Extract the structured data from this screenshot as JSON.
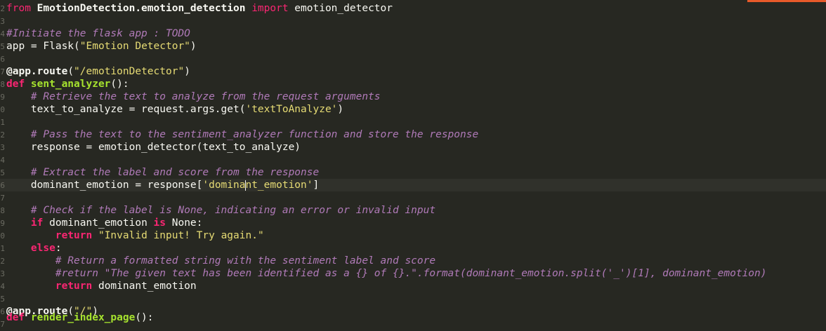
{
  "editor": {
    "line_numbers": [
      "2",
      "3",
      "4",
      "5",
      "6",
      "7",
      "8",
      "9",
      "0",
      "1",
      "2",
      "3",
      "4",
      "5",
      "6",
      "7",
      "8",
      "9",
      "0",
      "1",
      "2",
      "3",
      "4",
      "5",
      "6",
      "7"
    ],
    "lines": [
      {
        "tokens": [
          [
            "kw",
            "from "
          ],
          [
            "mod",
            "EmotionDetection.emotion_detection"
          ],
          [
            "kw",
            " import"
          ],
          [
            "plain",
            " emotion_detector"
          ]
        ]
      },
      {
        "tokens": []
      },
      {
        "tokens": [
          [
            "cm",
            "#Initiate the flask app : TODO"
          ]
        ]
      },
      {
        "tokens": [
          [
            "plain",
            "app = Flask("
          ],
          [
            "str",
            "\"Emotion Detector\""
          ],
          [
            "plain",
            ")"
          ]
        ]
      },
      {
        "tokens": []
      },
      {
        "tokens": [
          [
            "dec",
            "@app.route"
          ],
          [
            "plain",
            "("
          ],
          [
            "str",
            "\"/emotionDetector\""
          ],
          [
            "plain",
            ")"
          ]
        ]
      },
      {
        "tokens": [
          [
            "kwb",
            "def "
          ],
          [
            "fn",
            "sent_analyzer"
          ],
          [
            "plain",
            "():"
          ]
        ]
      },
      {
        "tokens": [
          [
            "plain",
            "    "
          ],
          [
            "cm",
            "# Retrieve the text to analyze from the request arguments"
          ]
        ]
      },
      {
        "tokens": [
          [
            "plain",
            "    text_to_analyze = request.args.get("
          ],
          [
            "str",
            "'textToAnalyze'"
          ],
          [
            "plain",
            ")"
          ]
        ]
      },
      {
        "tokens": []
      },
      {
        "tokens": [
          [
            "plain",
            "    "
          ],
          [
            "cm",
            "# Pass the text to the sentiment_analyzer function and store the response"
          ]
        ]
      },
      {
        "tokens": [
          [
            "plain",
            "    response = emotion_detector(text_to_analyze)"
          ]
        ]
      },
      {
        "tokens": []
      },
      {
        "tokens": [
          [
            "plain",
            "    "
          ],
          [
            "cm",
            "# Extract the label and score from the response"
          ]
        ]
      },
      {
        "tokens": [
          [
            "plain",
            "    dominant_emotion = response["
          ],
          [
            "str",
            "'domina"
          ],
          [
            "cursor",
            ""
          ],
          [
            "str",
            "nt_emotion'"
          ],
          [
            "plain",
            "]"
          ]
        ],
        "current": true
      },
      {
        "tokens": []
      },
      {
        "tokens": [
          [
            "plain",
            "    "
          ],
          [
            "cm",
            "# Check if the label is None, indicating an error or invalid input"
          ]
        ]
      },
      {
        "tokens": [
          [
            "plain",
            "    "
          ],
          [
            "kwb",
            "if"
          ],
          [
            "plain",
            " dominant_emotion "
          ],
          [
            "kwb",
            "is"
          ],
          [
            "plain",
            " None:"
          ]
        ]
      },
      {
        "tokens": [
          [
            "plain",
            "        "
          ],
          [
            "kwb",
            "return"
          ],
          [
            "plain",
            " "
          ],
          [
            "str",
            "\"Invalid input! Try again.\""
          ]
        ]
      },
      {
        "tokens": [
          [
            "plain",
            "    "
          ],
          [
            "kwb",
            "else"
          ],
          [
            "plain",
            ":"
          ]
        ]
      },
      {
        "tokens": [
          [
            "plain",
            "        "
          ],
          [
            "cm",
            "# Return a formatted string with the sentiment label and score"
          ]
        ]
      },
      {
        "tokens": [
          [
            "plain",
            "        "
          ],
          [
            "cm",
            "#return \"The given text has been identified as a {} of {}.\".format(dominant_emotion.split('_')[1], dominant_emotion)"
          ]
        ]
      },
      {
        "tokens": [
          [
            "plain",
            "        "
          ],
          [
            "kwb",
            "return"
          ],
          [
            "plain",
            " dominant_emotion"
          ]
        ]
      },
      {
        "tokens": []
      },
      {
        "tokens": [
          [
            "dec",
            "@app.route"
          ],
          [
            "plain",
            "("
          ],
          [
            "str",
            "\"/\""
          ],
          [
            "plain",
            ")"
          ]
        ]
      },
      {
        "tokens": [
          [
            "kwb",
            "def "
          ],
          [
            "fn",
            "render_index_page"
          ],
          [
            "plain",
            "():"
          ]
        ],
        "cut": true
      }
    ]
  },
  "colors": {
    "background": "#272822",
    "accent": "#e85a2a",
    "keyword": "#f92672",
    "function": "#a6e22e",
    "string": "#e6db74",
    "comment": "#b07ab8",
    "text": "#f8f8f2"
  }
}
